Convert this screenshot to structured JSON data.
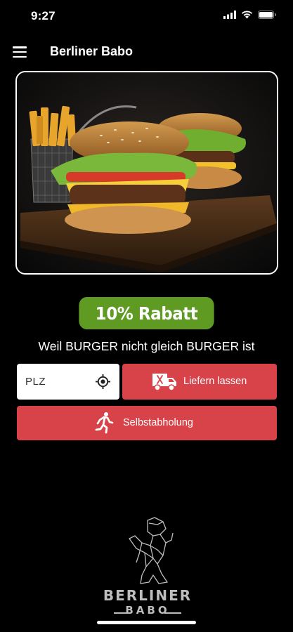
{
  "status_bar": {
    "time": "9:27"
  },
  "app_bar": {
    "title": "Berliner Babo"
  },
  "promo": {
    "label": "10% Rabatt",
    "color": "#5f9a22"
  },
  "tagline": "Weil BURGER nicht gleich BURGER ist",
  "plz": {
    "placeholder": "PLZ"
  },
  "actions": {
    "deliver_label": "Liefern lassen",
    "pickup_label": "Selbstabholung",
    "accent_color": "#d8434a"
  },
  "brand": {
    "word1": "BERLINER",
    "word2": "BABO"
  },
  "icons": {
    "menu": "menu-icon",
    "wifi": "wifi-icon",
    "battery": "battery-icon",
    "signal": "signal-icon",
    "locate": "locate-icon",
    "delivery": "delivery-van-icon",
    "pickup": "running-person-icon",
    "bear": "bear-logo"
  }
}
